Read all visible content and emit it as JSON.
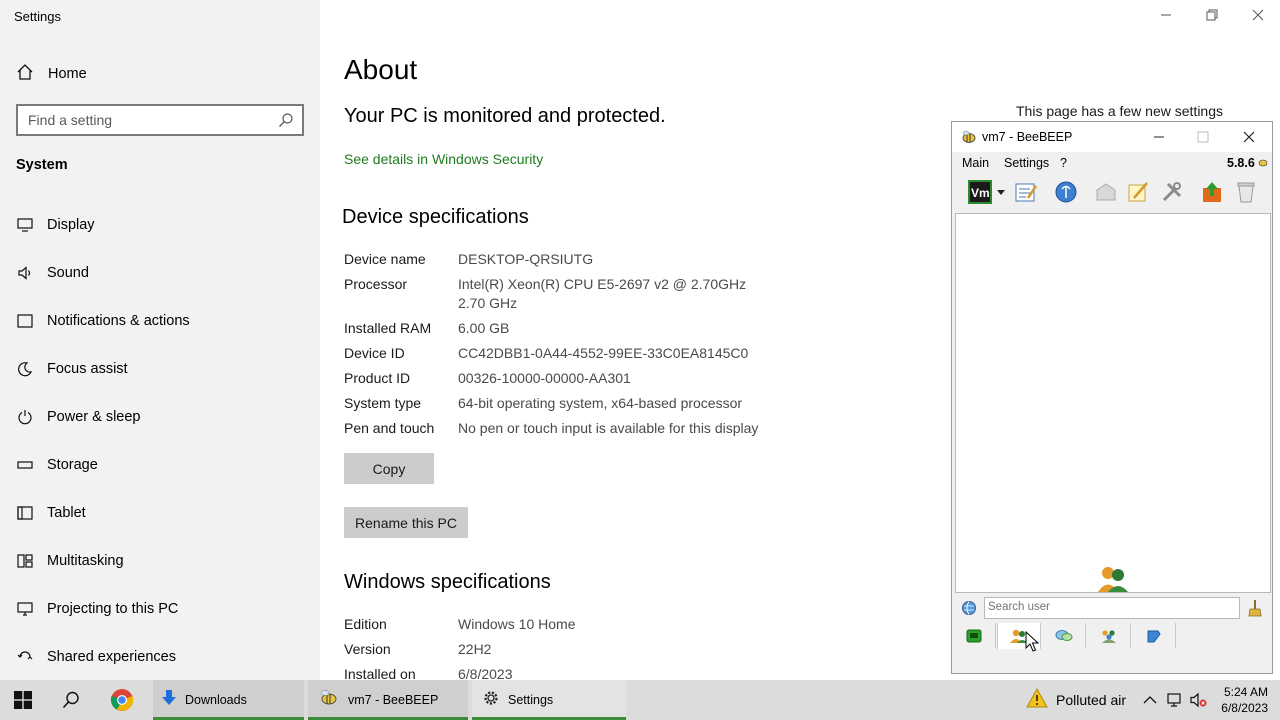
{
  "window": {
    "title": "Settings"
  },
  "sidebar": {
    "home_label": "Home",
    "search_placeholder": "Find a setting",
    "section_label": "System",
    "items": [
      {
        "label": "Display",
        "icon": "display-icon"
      },
      {
        "label": "Sound",
        "icon": "sound-icon"
      },
      {
        "label": "Notifications & actions",
        "icon": "notifications-icon"
      },
      {
        "label": "Focus assist",
        "icon": "focus-assist-icon"
      },
      {
        "label": "Power & sleep",
        "icon": "power-icon"
      },
      {
        "label": "Storage",
        "icon": "storage-icon"
      },
      {
        "label": "Tablet",
        "icon": "tablet-icon"
      },
      {
        "label": "Multitasking",
        "icon": "multitasking-icon"
      },
      {
        "label": "Projecting to this PC",
        "icon": "projecting-icon"
      },
      {
        "label": "Shared experiences",
        "icon": "shared-experiences-icon"
      }
    ]
  },
  "main": {
    "title": "About",
    "protect_message": "Your PC is monitored and protected.",
    "security_link": "See details in Windows Security",
    "device_heading": "Device specifications",
    "device_specs": [
      {
        "key": "Device name",
        "value": "DESKTOP-QRSIUTG"
      },
      {
        "key": "Processor",
        "value": "Intel(R) Xeon(R) CPU E5-2697 v2 @ 2.70GHz   2.70 GHz"
      },
      {
        "key": "Installed RAM",
        "value": "6.00 GB"
      },
      {
        "key": "Device ID",
        "value": "CC42DBB1-0A44-4552-99EE-33C0EA8145C0"
      },
      {
        "key": "Product ID",
        "value": "00326-10000-00000-AA301"
      },
      {
        "key": "System type",
        "value": "64-bit operating system, x64-based processor"
      },
      {
        "key": "Pen and touch",
        "value": "No pen or touch input is available for this display"
      }
    ],
    "copy_button": "Copy",
    "rename_button": "Rename this PC",
    "windows_heading": "Windows specifications",
    "windows_specs": [
      {
        "key": "Edition",
        "value": "Windows 10 Home"
      },
      {
        "key": "Version",
        "value": "22H2"
      },
      {
        "key": "Installed on",
        "value": "6/8/2023"
      }
    ],
    "notice": "This page has a few new settings"
  },
  "beebeep": {
    "title": "vm7 - BeeBEEP",
    "menu": [
      "Main",
      "Settings",
      "?"
    ],
    "version": "5.8.6",
    "search_placeholder": "Search user"
  },
  "taskbar": {
    "items": [
      {
        "label": "Downloads"
      },
      {
        "label": "vm7 - BeeBEEP"
      },
      {
        "label": "Settings"
      }
    ],
    "weather": "Polluted air",
    "time": "5:24 AM",
    "date": "6/8/2023"
  },
  "colors": {
    "link": "#1e7b1e",
    "sidebar_bg": "#f2f2f2",
    "taskbar_bg": "#dcdcdc",
    "active_indicator": "#3c8c3c"
  }
}
